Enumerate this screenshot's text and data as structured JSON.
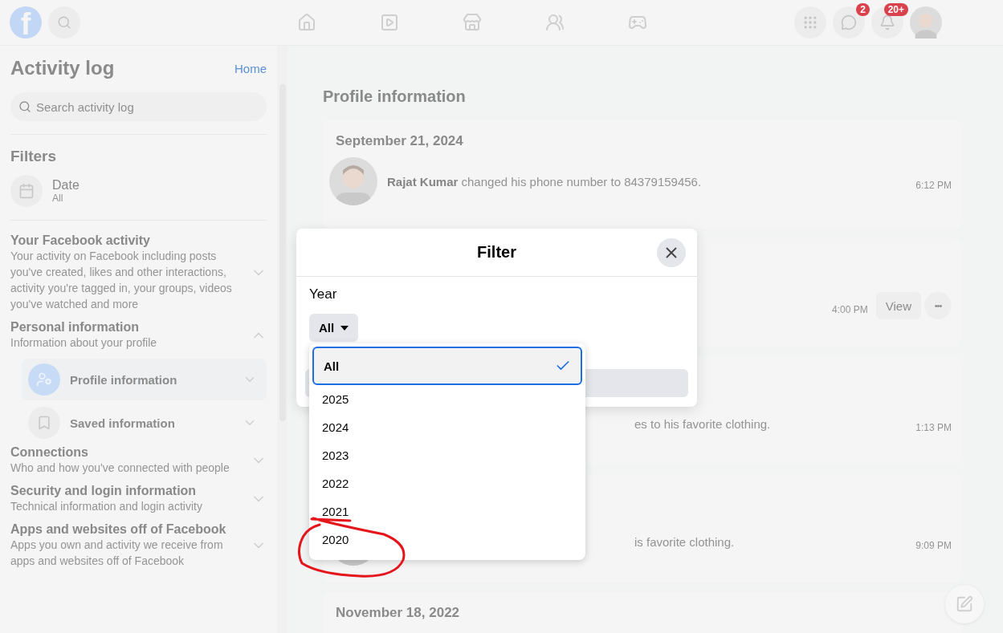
{
  "top_bar": {
    "logo": "f",
    "messenger_badge": "2",
    "notifications_badge": "20+"
  },
  "sidebar": {
    "title": "Activity log",
    "home_link": "Home",
    "search": {
      "placeholder": "Search activity log"
    },
    "filters_heading": "Filters",
    "filters": [
      {
        "label": "Date",
        "value": "All"
      }
    ],
    "sections": [
      {
        "title": "Your Facebook activity",
        "description": "Your activity on Facebook including posts you've created, likes and other interactions, activity you're tagged in, your groups, videos you've watched and more",
        "expanded": false
      },
      {
        "title": "Personal information",
        "description": "Information about your profile",
        "expanded": true,
        "children": [
          {
            "label": "Profile information",
            "selected": true,
            "kind": "profile"
          },
          {
            "label": "Saved information",
            "selected": false,
            "kind": "saved"
          }
        ]
      },
      {
        "title": "Connections",
        "description": "Who and how you've connected with people",
        "expanded": false
      },
      {
        "title": "Security and login information",
        "description": "Technical information and login activity",
        "expanded": false
      },
      {
        "title": "Apps and websites off of Facebook",
        "description": "Apps you own and activity we receive from apps and websites off of Facebook",
        "expanded": false
      }
    ]
  },
  "main": {
    "heading": "Profile information",
    "cards": [
      {
        "date": "September 21, 2024",
        "entry": {
          "avatar": true,
          "text": "**Rajat Kumar** changed his phone number to 84379159456.",
          "covered": false,
          "time": "6:12 PM"
        }
      },
      {
        "entry": {
          "time": "4:00 PM",
          "actions": [
            "View"
          ],
          "more": "•••"
        }
      },
      {
        "entry": {
          "text": "es to his favorite clothing.",
          "covered": true,
          "time": "1:13 PM"
        }
      },
      {
        "entry": {
          "avatar": true,
          "text": "is favorite clothing.",
          "covered": true,
          "time": "9:09 PM"
        }
      },
      {
        "date": "November 18, 2022"
      }
    ]
  },
  "filter_dialog": {
    "title": "Filter",
    "year_label": "Year",
    "year_select": {
      "value": "All",
      "expanded": true
    },
    "options": [
      {
        "label": "All",
        "selected": true
      },
      {
        "label": "2025",
        "selected": false
      },
      {
        "label": "2024",
        "selected": false
      },
      {
        "label": "2023",
        "selected": false
      },
      {
        "label": "2022",
        "selected": false
      },
      {
        "label": "2021",
        "selected": false
      },
      {
        "label": "2020",
        "selected": false
      }
    ]
  }
}
